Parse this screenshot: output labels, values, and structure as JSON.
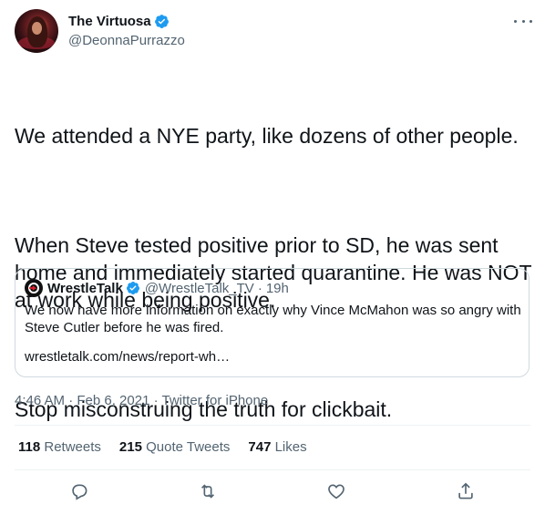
{
  "author": {
    "name": "The Virtuosa",
    "handle": "@DeonnaPurrazzo"
  },
  "tweet": {
    "paragraphs": [
      "We attended a NYE party, like dozens of other people.",
      "When Steve tested positive prior to SD, he was sent home and immediately started quarantine. He was NOT at work while being positive.",
      "Stop misconstruing the truth for clickbait."
    ]
  },
  "quote": {
    "name": "WrestleTalk",
    "handle": "@WrestleTalk_TV",
    "separator": "·",
    "time": "19h",
    "text": "We now have more information on exactly why Vince McMahon was so angry with Steve Cutler before he was fired.",
    "link": "wrestletalk.com/news/report-wh…"
  },
  "meta": {
    "text": "4:46 AM · Feb 6, 2021 · Twitter for iPhone"
  },
  "stats": [
    {
      "count": "118",
      "label": "Retweets"
    },
    {
      "count": "215",
      "label": "Quote Tweets"
    },
    {
      "count": "747",
      "label": "Likes"
    }
  ],
  "icons": {
    "verified": "verified-badge-icon",
    "more": "more-icon",
    "reply": "reply-icon",
    "retweet": "retweet-icon",
    "like": "like-icon",
    "share": "share-icon"
  },
  "colors": {
    "verified": "#1d9bf0",
    "text": "#0f1419",
    "secondary": "#536471",
    "border": "#cfd9de"
  }
}
